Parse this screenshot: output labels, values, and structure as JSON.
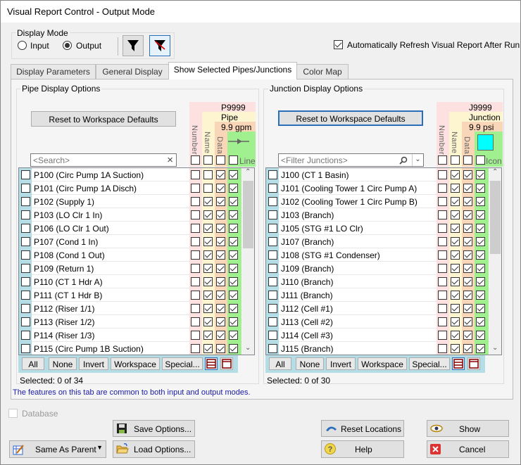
{
  "window": {
    "title": "Visual Report Control - Output Mode"
  },
  "display_mode": {
    "label": "Display Mode",
    "options": [
      {
        "label": "Input",
        "selected": false
      },
      {
        "label": "Output",
        "selected": true
      }
    ],
    "filter_icons": [
      "filter-icon",
      "filter-clear-icon"
    ]
  },
  "auto_refresh": {
    "label": "Automatically Refresh Visual Report After Run",
    "checked": true
  },
  "tabs": [
    {
      "label": "Display Parameters",
      "active": false
    },
    {
      "label": "General Display",
      "active": false
    },
    {
      "label": "Show Selected Pipes/Junctions",
      "active": true
    },
    {
      "label": "Color Map",
      "active": false
    }
  ],
  "pipe_panel": {
    "title": "Pipe Display Options",
    "reset_label": "Reset to Workspace Defaults",
    "search_placeholder": "<Search>",
    "clear_icon": "×",
    "preview": {
      "id": "P9999",
      "name": "Pipe",
      "data": "9.9 gpm",
      "line_label": "Line"
    },
    "col_headers": [
      "Number",
      "Name",
      "Data"
    ],
    "header_checks": [
      false,
      false,
      false,
      false
    ],
    "rows": [
      {
        "label": "P100 (Circ Pump 1A Suction)",
        "checks": [
          false,
          false,
          true,
          true
        ]
      },
      {
        "label": "P101 (Circ Pump 1A Disch)",
        "checks": [
          false,
          false,
          true,
          true
        ]
      },
      {
        "label": "P102 (Supply 1)",
        "checks": [
          false,
          true,
          true,
          true
        ]
      },
      {
        "label": "P103 (LO Clr 1 In)",
        "checks": [
          false,
          true,
          true,
          true
        ]
      },
      {
        "label": "P106 (LO Clr 1 Out)",
        "checks": [
          false,
          true,
          true,
          true
        ]
      },
      {
        "label": "P107 (Cond 1 In)",
        "checks": [
          false,
          true,
          true,
          true
        ]
      },
      {
        "label": "P108 (Cond 1 Out)",
        "checks": [
          false,
          true,
          true,
          true
        ]
      },
      {
        "label": "P109 (Return 1)",
        "checks": [
          false,
          true,
          true,
          true
        ]
      },
      {
        "label": "P110 (CT 1 Hdr A)",
        "checks": [
          false,
          true,
          true,
          true
        ]
      },
      {
        "label": "P111 (CT 1 Hdr B)",
        "checks": [
          false,
          true,
          true,
          true
        ]
      },
      {
        "label": "P112 (Riser 1/1)",
        "checks": [
          false,
          true,
          true,
          true
        ]
      },
      {
        "label": "P113 (Riser 1/2)",
        "checks": [
          false,
          true,
          true,
          true
        ]
      },
      {
        "label": "P114 (Riser 1/3)",
        "checks": [
          false,
          true,
          true,
          true
        ]
      },
      {
        "label": "P115 (Circ Pump 1B Suction)",
        "checks": [
          false,
          true,
          true,
          true
        ]
      }
    ],
    "buttons": [
      "All",
      "None",
      "Invert",
      "Workspace",
      "Special..."
    ],
    "status": "Selected: 0 of 34"
  },
  "junction_panel": {
    "title": "Junction Display Options",
    "reset_label": "Reset to Workspace Defaults",
    "search_placeholder": "<Filter Junctions>",
    "preview": {
      "id": "J9999",
      "name": "Junction",
      "data": "9.9 psi",
      "icon_label": "Icon",
      "icon_color": "#00ffff"
    },
    "col_headers": [
      "Number",
      "Name",
      "Data"
    ],
    "header_checks": [
      false,
      false,
      false,
      false
    ],
    "rows": [
      {
        "label": "J100 (CT 1 Basin)",
        "checks": [
          false,
          true,
          true,
          true
        ]
      },
      {
        "label": "J101 (Cooling Tower 1 Circ Pump A)",
        "checks": [
          false,
          true,
          true,
          true
        ]
      },
      {
        "label": "J102 (Cooling Tower 1 Circ Pump B)",
        "checks": [
          false,
          true,
          true,
          true
        ]
      },
      {
        "label": "J103 (Branch)",
        "checks": [
          false,
          true,
          true,
          true
        ]
      },
      {
        "label": "J105 (STG #1 LO Clr)",
        "checks": [
          false,
          true,
          true,
          true
        ]
      },
      {
        "label": "J107 (Branch)",
        "checks": [
          false,
          true,
          true,
          true
        ]
      },
      {
        "label": "J108 (STG #1 Condenser)",
        "checks": [
          false,
          true,
          true,
          true
        ]
      },
      {
        "label": "J109 (Branch)",
        "checks": [
          false,
          true,
          true,
          true
        ]
      },
      {
        "label": "J110 (Branch)",
        "checks": [
          false,
          true,
          true,
          true
        ]
      },
      {
        "label": "J111 (Branch)",
        "checks": [
          false,
          true,
          true,
          true
        ]
      },
      {
        "label": "J112 (Cell #1)",
        "checks": [
          false,
          true,
          true,
          true
        ]
      },
      {
        "label": "J113 (Cell #2)",
        "checks": [
          false,
          true,
          true,
          true
        ]
      },
      {
        "label": "J114 (Cell #3)",
        "checks": [
          false,
          true,
          true,
          true
        ]
      },
      {
        "label": "J115 (Branch)",
        "checks": [
          false,
          true,
          true,
          true
        ]
      }
    ],
    "buttons": [
      "All",
      "None",
      "Invert",
      "Workspace",
      "Special..."
    ],
    "status": "Selected: 0 of 30"
  },
  "note": "The features on this tab are common to both input and output modes.",
  "database": {
    "label": "Database",
    "checked": false,
    "enabled": false
  },
  "bottom": {
    "same_as_parent": "Same As Parent",
    "save_options": "Save Options...",
    "load_options": "Load Options...",
    "reset_locations": "Reset Locations",
    "help": "Help",
    "show": "Show",
    "cancel": "Cancel"
  },
  "colors": {
    "number_col": "#fde0e0",
    "name_col": "#fdf5d0",
    "data_col": "#fad6b8",
    "line_col": "#a0f090",
    "select_col": "#b4dde6",
    "note_text": "#1a1aa8"
  }
}
